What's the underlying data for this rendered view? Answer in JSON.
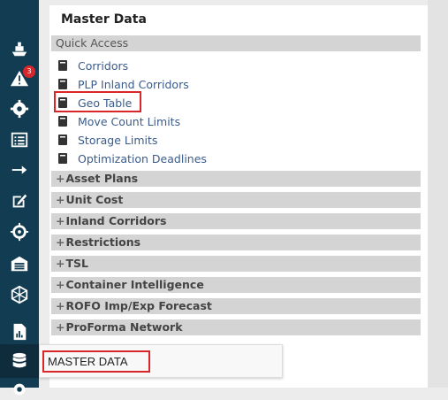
{
  "sidebar": {
    "alert_badge": "3",
    "icons": [
      "ship-icon",
      "alert-icon",
      "gear-icon",
      "list-icon",
      "arrow-right-icon",
      "edit-icon",
      "crosshair-icon",
      "warehouse-icon",
      "network-icon",
      "report-icon",
      "database-icon",
      "settings-icon"
    ]
  },
  "panel": {
    "title": "Master Data",
    "quick_access": {
      "title": "Quick Access",
      "items": [
        "Corridors",
        "PLP Inland Corridors",
        "Geo Table",
        "Move Count Limits",
        "Storage Limits",
        "Optimization Deadlines"
      ]
    },
    "sections": [
      "Asset Plans",
      "Unit Cost",
      "Inland Corridors",
      "Restrictions",
      "TSL",
      "Container Intelligence",
      "ROFO Imp/Exp Forecast",
      "ProForma Network"
    ]
  },
  "tooltip": {
    "text": "MASTER DATA"
  },
  "colors": {
    "sidebar": "#123c52",
    "link": "#3a5b8c",
    "highlight": "#d9262a",
    "section_bar": "#d4d4d4"
  }
}
